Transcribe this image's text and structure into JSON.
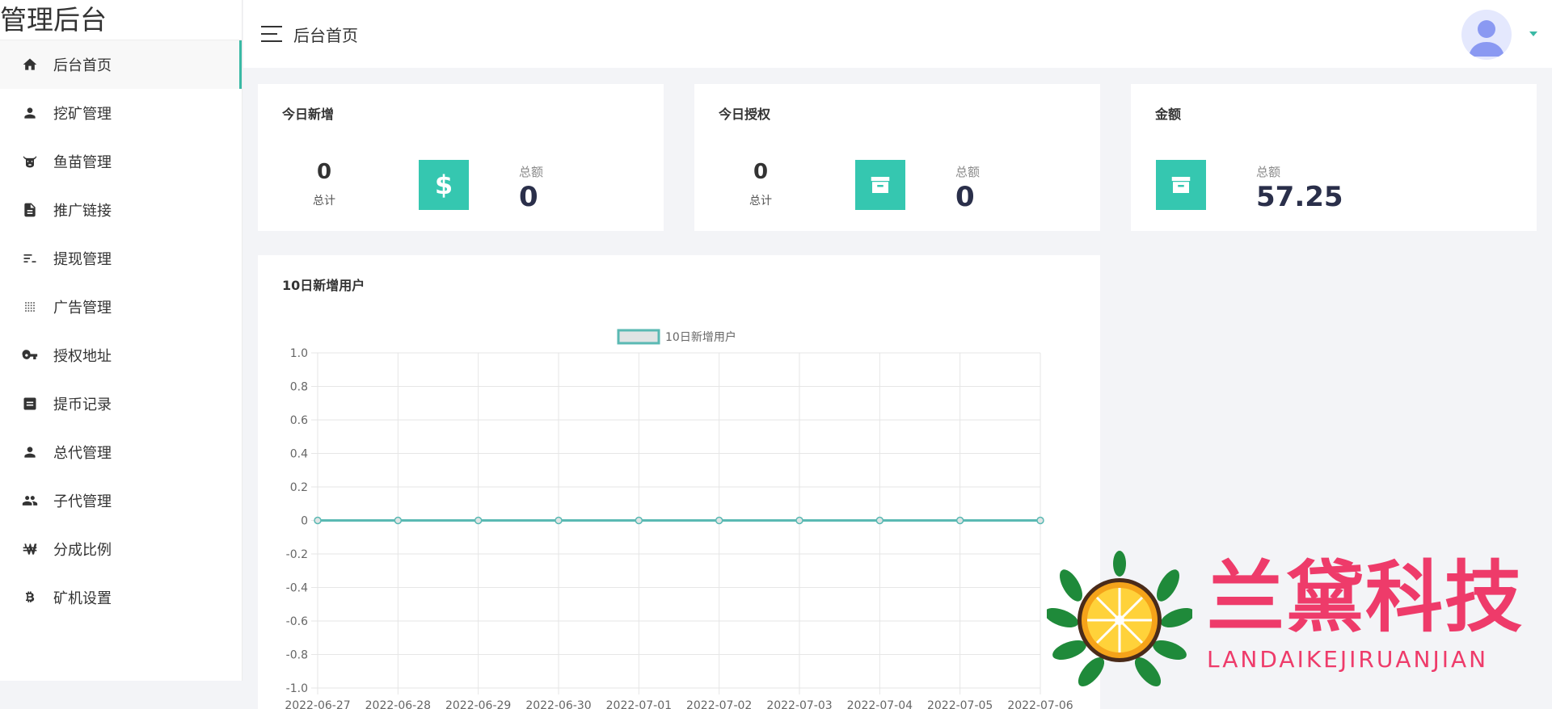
{
  "brand": "管理后台",
  "sidebar": {
    "items": [
      {
        "label": "后台首页",
        "icon": "home-icon"
      },
      {
        "label": "挖矿管理",
        "icon": "person-icon"
      },
      {
        "label": "鱼苗管理",
        "icon": "cow-icon"
      },
      {
        "label": "推广链接",
        "icon": "document-icon"
      },
      {
        "label": "提现管理",
        "icon": "sort-icon"
      },
      {
        "label": "广告管理",
        "icon": "grid-icon"
      },
      {
        "label": "授权地址",
        "icon": "key-icon"
      },
      {
        "label": "提币记录",
        "icon": "record-icon"
      },
      {
        "label": "总代管理",
        "icon": "person-icon"
      },
      {
        "label": "子代管理",
        "icon": "group-icon"
      },
      {
        "label": "分成比例",
        "icon": "won-icon"
      },
      {
        "label": "矿机设置",
        "icon": "bitcoin-icon"
      }
    ]
  },
  "topbar": {
    "title": "后台首页"
  },
  "cards": [
    {
      "title": "今日新增",
      "count": "0",
      "count_label": "总计",
      "icon": "dollar-icon",
      "total_label": "总额",
      "total": "0"
    },
    {
      "title": "今日授权",
      "count": "0",
      "count_label": "总计",
      "icon": "archive-icon",
      "total_label": "总额",
      "total": "0"
    },
    {
      "title": "金额",
      "icon": "archive-icon",
      "total_label": "总额",
      "total": "57.25"
    }
  ],
  "chart_card": {
    "title": "10日新增用户"
  },
  "chart_data": {
    "type": "line",
    "x": [
      "2022-06-27",
      "2022-06-28",
      "2022-06-29",
      "2022-06-30",
      "2022-07-01",
      "2022-07-02",
      "2022-07-03",
      "2022-07-04",
      "2022-07-05",
      "2022-07-06"
    ],
    "series": [
      {
        "name": "10日新增用户",
        "values": [
          0,
          0,
          0,
          0,
          0,
          0,
          0,
          0,
          0,
          0
        ]
      }
    ],
    "y_ticks": [
      "1.0",
      "0.8",
      "0.6",
      "0.4",
      "0.2",
      "0",
      "-0.2",
      "-0.4",
      "-0.6",
      "-0.8",
      "-1.0"
    ],
    "ylim": [
      -1.0,
      1.0
    ],
    "grid": true,
    "legend": "top-center",
    "color": "#5ab9b3"
  },
  "watermark": {
    "title": "兰黛科技",
    "subtitle": "LANDAIKEJIRUANJIAN"
  },
  "colors": {
    "accent": "#35c7b0",
    "watermark": "#ee3b6a"
  }
}
